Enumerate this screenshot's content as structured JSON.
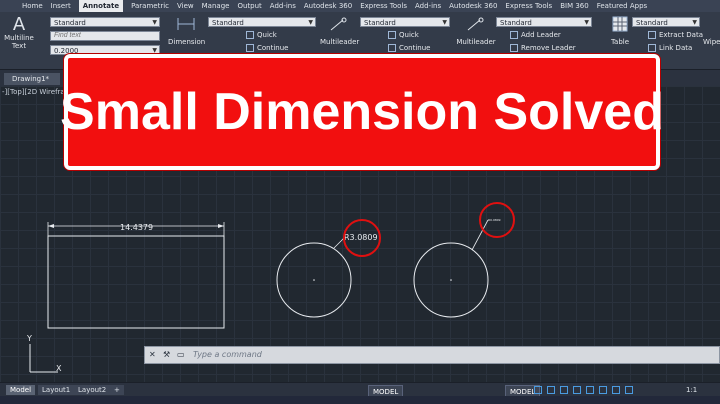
{
  "ribbon": {
    "tabs": [
      "Home",
      "Insert",
      "Annotate",
      "Parametric",
      "View",
      "Manage",
      "Output",
      "Add-ins",
      "Autodesk 360",
      "Express Tools",
      "Add-ins",
      "Autodesk 360",
      "Express Tools",
      "BIM 360",
      "Featured Apps"
    ],
    "active_tab": "Annotate",
    "text_panel": {
      "multiline_label": "Multiline\nText",
      "style_value": "Standard",
      "find_placeholder": "Find text",
      "height_value": "0.2000"
    },
    "dimension_panel": {
      "label": "Dimension",
      "style_value": "Standard",
      "quick_label": "Quick",
      "continue_label": "Continue"
    },
    "leaders_panel_1": {
      "label": "Multileader",
      "style_value": "Standard",
      "quick_label": "Quick",
      "continue_label": "Continue"
    },
    "leaders_panel_2": {
      "label": "Multileader",
      "style_value": "Standard",
      "add_leader_label": "Add Leader",
      "remove_leader_label": "Remove Leader"
    },
    "table_panel": {
      "label": "Table",
      "style_value": "Standard",
      "extract_label": "Extract Data",
      "link_label": "Link Data"
    },
    "wipeout_label": "Wipe"
  },
  "document": {
    "tab_label": "Drawing1*",
    "view_label": "-][Top][2D Wirefram"
  },
  "banner": {
    "text": "Small Dimension Solved"
  },
  "drawing": {
    "linear_dimension": "14.4379",
    "radius_dimension": "R3.0809",
    "small_radius_dimension": "R0.0809",
    "ucs_y": "Y",
    "ucs_x": "X"
  },
  "command": {
    "placeholder": "Type a command"
  },
  "status": {
    "layout_tabs": [
      "Model",
      "Layout1",
      "Layout2"
    ],
    "model_button": "MODEL",
    "model_button_2": "MODEL",
    "scale": "1:1"
  },
  "colors": {
    "banner_red": "#f20f0f",
    "highlight_circle": "#e01010",
    "canvas": "#212830"
  }
}
